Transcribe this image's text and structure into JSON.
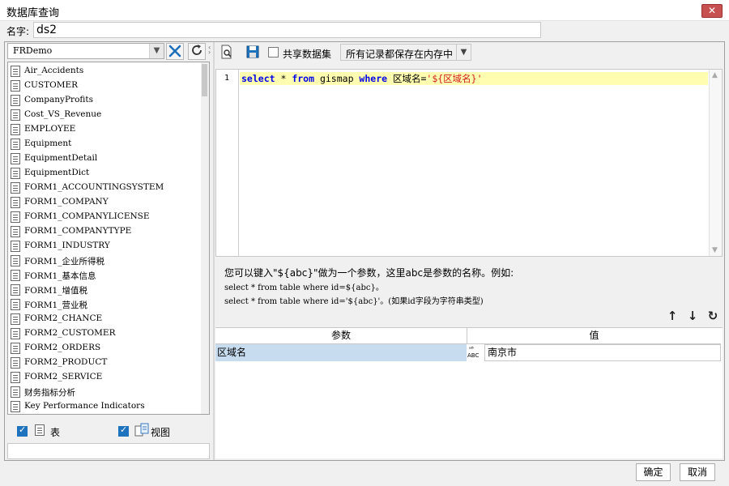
{
  "window": {
    "title": "数据库查询",
    "close_label": "✕"
  },
  "name_field": {
    "label": "名字:",
    "value": "ds2"
  },
  "left_pane": {
    "datasource": "FRDemo",
    "tables": [
      "Air_Accidents",
      "CUSTOMER",
      "CompanyProfits",
      "Cost_VS_Revenue",
      "EMPLOYEE",
      "Equipment",
      "EquipmentDetail",
      "EquipmentDict",
      "FORM1_ACCOUNTINGSYSTEM",
      "FORM1_COMPANY",
      "FORM1_COMPANYLICENSE",
      "FORM1_COMPANYTYPE",
      "FORM1_INDUSTRY",
      "FORM1_企业所得税",
      "FORM1_基本信息",
      "FORM1_增值税",
      "FORM1_营业税",
      "FORM2_CHANCE",
      "FORM2_CUSTOMER",
      "FORM2_ORDERS",
      "FORM2_PRODUCT",
      "FORM2_SERVICE",
      "财务指标分析",
      "Key Performance Indicators"
    ],
    "show_tables_label": "表",
    "show_views_label": "视图",
    "show_tables_checked": true,
    "show_views_checked": true
  },
  "right_pane": {
    "share_label": "共享数据集",
    "save_mode": "所有记录都保存在内存中",
    "editor": {
      "line_number": "1",
      "code": {
        "kw_select": "select",
        "star": " * ",
        "kw_from": "from",
        "table": " gismap ",
        "kw_where": "where",
        "cond": " 区域名=",
        "param": "'${区域名}'"
      }
    },
    "hint": {
      "line1": "您可以键入\"${abc}\"做为一个参数，这里abc是参数的名称。例如:",
      "line2": "select * from table where id=${abc}。",
      "line3": "select * from table where id='${abc}'。(如果id字段为字符串类型)"
    },
    "params": {
      "header_name": "参数",
      "header_value": "值",
      "rows": [
        {
          "name": "区域名",
          "type_icon": "ABC",
          "value": "南京市"
        }
      ]
    }
  },
  "buttons": {
    "ok": "确定",
    "cancel": "取消"
  }
}
